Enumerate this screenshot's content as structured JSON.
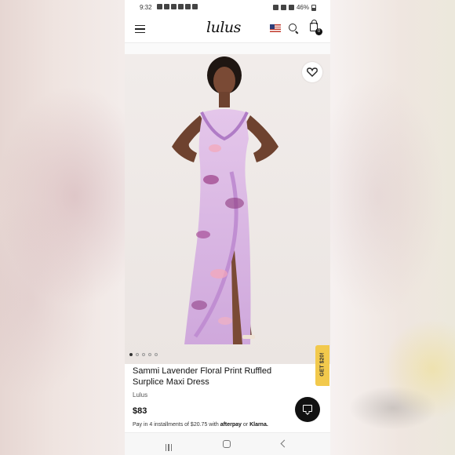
{
  "status_bar": {
    "time": "9:32",
    "battery": "46%"
  },
  "header": {
    "logo_text": "lulus",
    "cart_count": "0",
    "icons": [
      "menu-icon",
      "us-flag-icon",
      "search-icon",
      "shopping-bag-icon"
    ]
  },
  "product": {
    "image_dot_count": 5,
    "active_dot_index": 0,
    "title": "Sammi Lavender Floral Print Ruffled Surplice Maxi Dress",
    "brand": "Lulus",
    "price": "$83",
    "installments_prefix": "Pay in 4 installments of $20.75 with",
    "afterpay_label": "afterpay",
    "or_text": "or",
    "klarna_label": "Klarna."
  },
  "promo_tab": {
    "label": "GET $20!"
  },
  "colors": {
    "promo": "#f2c94c",
    "dress": "#d8b4e2",
    "chat_button": "#111111"
  }
}
